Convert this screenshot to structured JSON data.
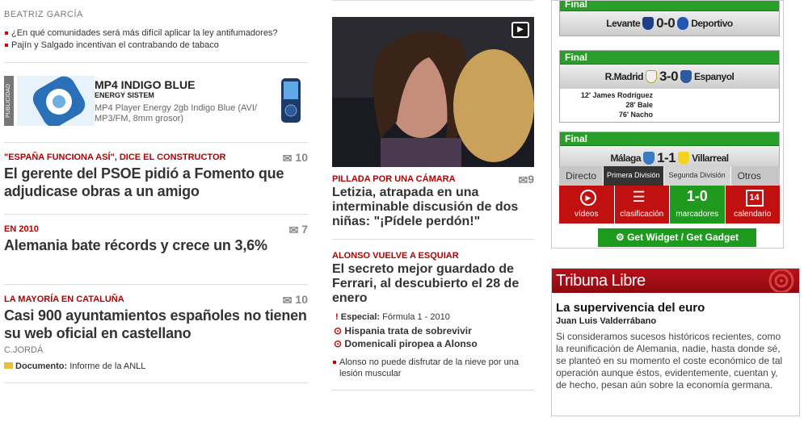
{
  "col1": {
    "author": "BEATRIZ GARCÍA",
    "bullets": [
      "¿En qué comunidades será más difícil aplicar la ley antifumadores?",
      "Pajín y Salgado incentivan el contrabando de tabaco"
    ],
    "ad": {
      "tag": "PUBLICIDAD",
      "title": "MP4 INDIGO BLUE",
      "subtitle": "ENERGY SISTEM",
      "desc": "MP4 Player Energy 2gb Indigo Blue (AVI/ MP3/FM, 8mm grosor)"
    },
    "stories": [
      {
        "kicker": "\"ESPAÑA FUNCIONA ASÍ\", DICE EL CONSTRUCTOR",
        "headline": "El gerente del PSOE pidió a Fomento que adjudicase obras a un amigo",
        "count": "10"
      },
      {
        "kicker": "EN 2010",
        "headline": "Alemania bate récords y crece un 3,6%",
        "count": "7"
      },
      {
        "kicker": "LA MAYORÍA EN CATALUÑA",
        "headline": "Casi 900 ayuntamientos españoles no tienen su web oficial en castellano",
        "count": "10",
        "byline": "C.JORDÁ",
        "doc_label": "Documento:",
        "doc_text": "Informe de la ANLL"
      }
    ]
  },
  "col2": {
    "stories": [
      {
        "kicker": "PILLADA POR UNA CÁMARA",
        "headline": "Letizia, atrapada en una interminable discusión de dos niñas: \"¡Pídele perdón!\"",
        "count": "9"
      },
      {
        "kicker": "ALONSO VUELVE A ESQUIAR",
        "headline": "El secreto mejor guardado de Ferrari, al descubierto el 28 de enero",
        "special_label": "Especial:",
        "special_text": "Fórmula 1 - 2010",
        "links": [
          "Hispania trata de sobrevivir",
          "Domenicali piropea a Alonso"
        ],
        "bullet": "Alonso no puede disfrutar de la nieve por una lesión muscular"
      }
    ]
  },
  "col3": {
    "matches": [
      {
        "status": "Final",
        "home": "Levante",
        "score": "0-0",
        "away": "Deportivo"
      },
      {
        "status": "Final",
        "home": "R.Madrid",
        "score": "3-0",
        "away": "Espanyol",
        "goals": [
          "12' James Rodríguez",
          "28' Bale",
          "76' Nacho"
        ]
      },
      {
        "status": "Final",
        "home": "Málaga",
        "score": "1-1",
        "away": "Villarreal"
      }
    ],
    "tabs": [
      "Directo",
      "Primera División",
      "Segunda División",
      "Otros"
    ],
    "icons": [
      {
        "label": "vídeos"
      },
      {
        "label": "clasificación"
      },
      {
        "label": "marcadores",
        "value": "1-0"
      },
      {
        "label": "calendario",
        "value": "14"
      }
    ],
    "widget": "Get Widget / Get Gadget",
    "tribuna": {
      "title": "Tribuna Libre",
      "headline": "La supervivencia del euro",
      "author": "Juan Luis Valderrábano",
      "body": "Si consideramos sucesos históricos recientes, como la reunificación de Alemania, nadie, hasta donde sé, se planteó en su momento el coste económico de tal operación aunque éstos, evidentemente, cuentan y, de hecho, pesan aún sobre la economía germana."
    }
  }
}
